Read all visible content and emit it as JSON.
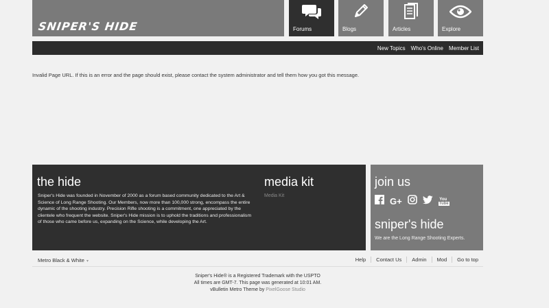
{
  "header": {
    "logo": "SNIPER'S HIDE",
    "tiles": [
      {
        "label": "Forums",
        "icon": "chat-bubbles-icon",
        "active": true
      },
      {
        "label": "Blogs",
        "icon": "pencil-icon",
        "active": false
      },
      {
        "label": "Articles",
        "icon": "document-icon",
        "active": false
      },
      {
        "label": "Explore",
        "icon": "eye-icon",
        "active": false
      }
    ]
  },
  "navbar": {
    "links": [
      "New Topics",
      "Who's Online",
      "Member List"
    ]
  },
  "main": {
    "message": "Invalid Page URL. If this is an error and the page should exist, please contact the system administrator and tell them how you got this message."
  },
  "footer": {
    "hide_title": "the hide",
    "hide_text": "Sniper's Hide was founded in November of 2000 as a forum based community dedicated to the Art & Science of Long Range Shooting. Our Members, now more than 100,000 strong, encompass the entire dynamic of the shooting industry. Precision Rifle shooting is a commitment, one appreciated by the clientele who frequent the website. Sniper's Hide mission is to uphold the traditions and professionalism of those who came before us, expanding on the Science, while developing the Art.",
    "media_title": "media kit",
    "media_link": "Media Kit",
    "join_title": "join us",
    "social": [
      {
        "icon": "facebook-icon",
        "glyph": "f"
      },
      {
        "icon": "google-plus-icon",
        "glyph": "G+"
      },
      {
        "icon": "instagram-icon",
        "glyph": ""
      },
      {
        "icon": "twitter-icon",
        "glyph": ""
      },
      {
        "icon": "youtube-icon",
        "glyph": "You Tube"
      }
    ],
    "sh_title": "sniper's hide",
    "sh_text": "We are the Long Range Shooting Experts."
  },
  "footbar": {
    "theme": "Metro Black & White",
    "links": [
      "Help",
      "Contact Us",
      "Admin",
      "Mod",
      "Go to top"
    ]
  },
  "copyright": {
    "line1": "Sniper's Hide® is a Registered Trademark with the USPTO",
    "line2": "All times are GMT-7. This page was generated at 10:01 AM.",
    "line3_prefix": "vBulletin Metro Theme by ",
    "line3_studio": "PixelGoose Studio"
  },
  "colors": {
    "tile_gray": "#7a7a7a",
    "dark": "#2f2f2f",
    "background": "#f1f1f1"
  }
}
